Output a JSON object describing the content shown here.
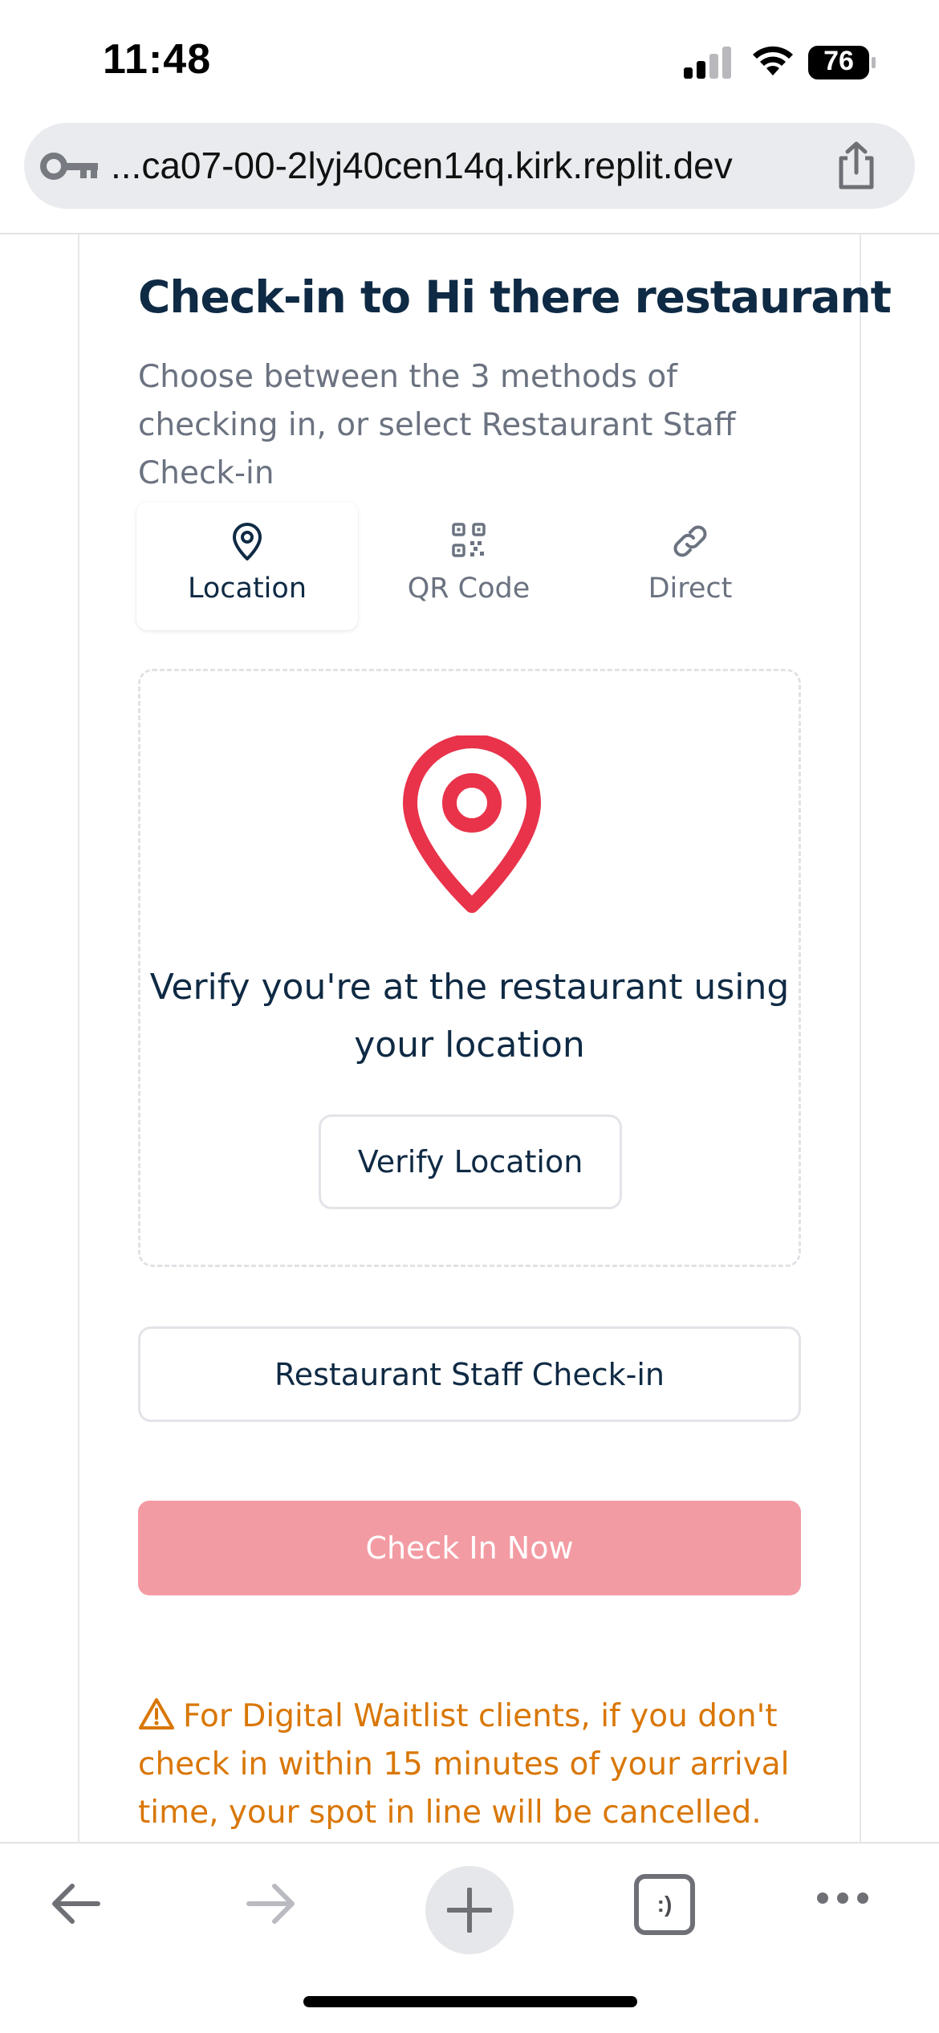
{
  "status_bar": {
    "time": "11:48",
    "battery": "76",
    "icons": [
      "signal-icon",
      "wifi-icon",
      "battery-icon"
    ]
  },
  "browser": {
    "url": "...ca07-00-2lyj40cen14q.kirk.replit.dev",
    "icons": [
      "key-icon",
      "share-icon"
    ]
  },
  "checkin": {
    "title": "Check-in to Hi there restaurant",
    "subtitle": "Choose between the 3 methods of checking in, or select Restaurant Staff Check-in",
    "tabs": [
      {
        "label": "Location",
        "icon": "map-pin-icon",
        "active": true
      },
      {
        "label": "QR Code",
        "icon": "qr-code-icon",
        "active": false
      },
      {
        "label": "Direct",
        "icon": "link-icon",
        "active": false
      }
    ],
    "location_panel": {
      "icon": "map-pin-icon",
      "accent_color": "#e8334a",
      "text": "Verify you're at the restaurant using your location",
      "verify_button": "Verify Location"
    },
    "staff_button": "Restaurant Staff Check-in",
    "checkin_button": "Check In Now",
    "checkin_button_color": "#f39ba3",
    "warning": "For Digital Waitlist clients, if you don't check in within 15 minutes of your arrival time, your spot in line will be cancelled.",
    "warning_color": "#d97706"
  },
  "toolbar": {
    "items": [
      "back-arrow-icon",
      "forward-arrow-icon",
      "plus-icon",
      "tabs-icon",
      "more-icon"
    ],
    "tabs_badge": ":)"
  }
}
